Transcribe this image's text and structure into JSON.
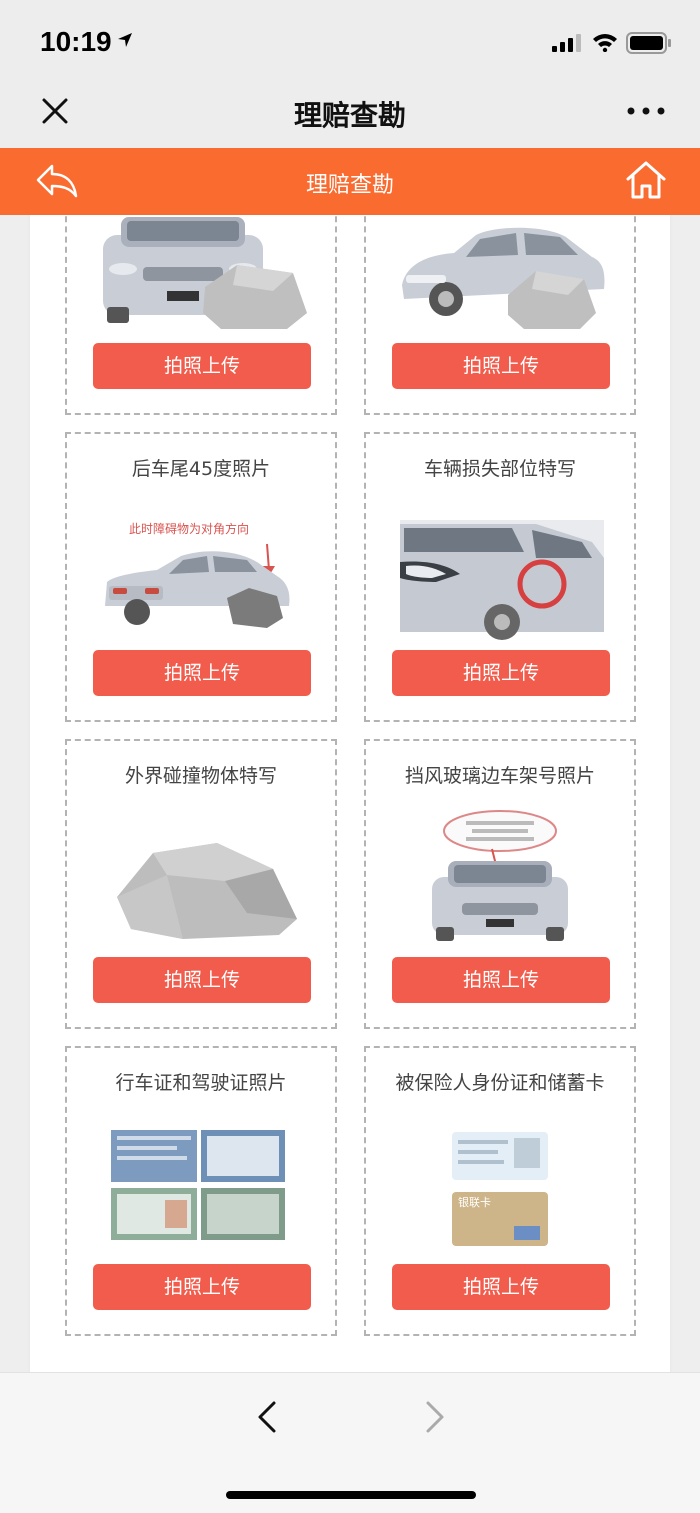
{
  "status_bar": {
    "time": "10:19"
  },
  "wechat_nav": {
    "title": "理赔查勘"
  },
  "app_header": {
    "title": "理赔查勘"
  },
  "cards": [
    {
      "title": "",
      "image": "car-front-obstacle",
      "button": "拍照上传"
    },
    {
      "title": "",
      "image": "car-side-obstacle",
      "button": "拍照上传"
    },
    {
      "title": "后车尾45度照片",
      "image": "car-rear-45-with-note",
      "image_caption": "此时障碍物为对角方向",
      "button": "拍照上传"
    },
    {
      "title": "车辆损失部位特写",
      "image": "damage-closeup",
      "button": "拍照上传"
    },
    {
      "title": "外界碰撞物体特写",
      "image": "rock-closeup",
      "button": "拍照上传"
    },
    {
      "title": "挡风玻璃边车架号照片",
      "image": "vin-windshield",
      "button": "拍照上传"
    },
    {
      "title": "行车证和驾驶证照片",
      "image": "license-documents",
      "button": "拍照上传"
    },
    {
      "title": "被保险人身份证和储蓄卡",
      "image": "id-and-bank-card",
      "image_caption": "银联卡",
      "button": "拍照上传"
    }
  ],
  "colors": {
    "header": "#fa6b30",
    "button": "#f25c4c"
  },
  "icons": [
    "location-arrow-icon",
    "signal-icon",
    "wifi-icon",
    "battery-icon",
    "close-icon",
    "more-icon",
    "back-arrow-icon",
    "home-icon",
    "chevron-left-icon",
    "chevron-right-icon"
  ]
}
